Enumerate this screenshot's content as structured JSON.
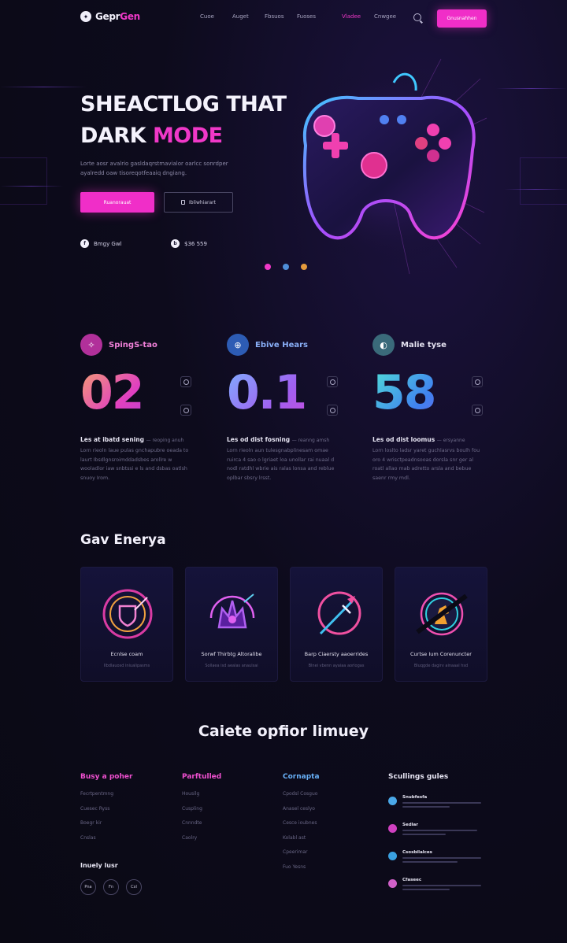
{
  "nav": {
    "logo_prefix": "Gepr",
    "logo_accent": "Gen",
    "links": [
      "Cuoe",
      "Auget",
      "Fbsuos",
      "Fuoses",
      "Vladee",
      "Cnwgee"
    ],
    "active_index": 4,
    "cta_label": "Gnusnahhen"
  },
  "hero": {
    "title_line1": "SHEACTLOG THAT",
    "title_line2_plain": "DARK",
    "title_line2_accent": "MODE",
    "subtitle": "Lorte aosr avalrio gasldaqrstmavialor oarlcc sonrdper ayalredd oaw tisoreqotfeaaiq dngiang.",
    "primary_button": "Ruanorauat",
    "secondary_button": "Ibliwhiarart",
    "meta": [
      {
        "icon": "f",
        "label": "Bmgy Gwl"
      },
      {
        "icon": "b",
        "label": "$36 559"
      }
    ],
    "dot_colors": [
      "#f038c8",
      "#4f8ed8",
      "#e59a3c"
    ]
  },
  "stats": [
    {
      "title": "SpingS-tao",
      "value": "02",
      "lead": "Les at ibatd sening",
      "lead_tail": "— reoping anuh",
      "body": "Lorn rieoln laue pulas gnchapubre oeada to laurt Ibsdlgnsroimddadsbes arollre w wooladlor iaw snbtssi e ls and dsbas oatlsh snuoy Irom.",
      "icon": "✧",
      "icon_bg": "#b1309a",
      "title_color": "#f080d8",
      "grad": "linear-gradient(135deg,#f5a070 0%,#e040c0 45%,#9040e0 100%)"
    },
    {
      "title": "Ebive Hears",
      "value": "0.1",
      "lead": "Les od dist fosning",
      "lead_tail": "— reanng amsh",
      "body": "Lorn rieoln aun tulesgnabplinesam omae ruirca 4 sao o lgriaet loa unollar rai nuaal d nodl ratdhl wbrie ais ralas lonsa and reblue oplbar sbsry lrsst.",
      "icon": "⊕",
      "icon_bg": "#2d5cb4",
      "title_color": "#8ab0f8",
      "grad": "linear-gradient(135deg,#7fb0ff 0%,#a060f0 50%,#e040d0 100%)"
    },
    {
      "title": "Malie tyse",
      "value": "58",
      "lead": "Les od dist loomus",
      "lead_tail": "— ersyanne",
      "body": "Lorn loslto ladsr yaret guchlasrvs boulh fou oro 4 wrisctpeadnsooas dorsla snr ger al roatl allao mab adretto arsla and bebue saenr rmy mdl.",
      "icon": "◐",
      "icon_bg": "#3a6a7a",
      "title_color": "#e4e2f0",
      "grad": "linear-gradient(135deg,#50e0d8 0%,#4080f0 50%,#a050e0 100%)"
    }
  ],
  "energy": {
    "title": "Gav Enerya",
    "cards": [
      {
        "title": "Ecnlse coam",
        "sub": "Ilbdlauosd iniualipasms",
        "icon": "shield-icon",
        "c1": "#f040b0",
        "c2": "#f0a040"
      },
      {
        "title": "Sorwf Thirbtg Altoralibe",
        "sub": "Sollaea isd aealas anaulsai",
        "icon": "crown-icon",
        "c1": "#9040e0",
        "c2": "#e060f0"
      },
      {
        "title": "Barp Ciaersty aaoerrides",
        "sub": "Blnei vbenn ayaiaa aorlogas",
        "icon": "sword-icon",
        "c1": "#f050a0",
        "c2": "#40c0f0"
      },
      {
        "title": "Curtse Ium Corenuncter",
        "sub": "Bluqgde dagirv ainaaal hsd",
        "icon": "warrior-icon",
        "c1": "#30d0e0",
        "c2": "#f0a030"
      }
    ]
  },
  "footer": {
    "title": "Caiete opfior limuey",
    "columns": [
      {
        "title": "Busy a poher",
        "color": "#f050d0",
        "items": [
          "Fecrtpentmng",
          "Cuesec Ryss",
          "Boegr kir",
          "Cnslas"
        ]
      },
      {
        "title": "Parftulled",
        "color": "#f050d0",
        "items": [
          "Housilg",
          "Cuspling",
          "Cnnndte",
          "Caolry"
        ]
      },
      {
        "title": "Cornapta",
        "color": "#68b0f8",
        "items": [
          "Cpodsl Cosguo",
          "Anasel ceslyo",
          "Cesce ioubnes",
          "Kolabl ast",
          "Cpeerimar",
          "Fuo Yesns"
        ]
      }
    ],
    "social_title": "Inuely lusr",
    "social": [
      "Pna",
      "Fn",
      "Cxl"
    ],
    "news_title": "Scullings gules",
    "news": [
      {
        "label": "Snubfesfa",
        "color": "#4aa8e8"
      },
      {
        "label": "Sedlar",
        "color": "#d040c0"
      },
      {
        "label": "Csosbilalces",
        "color": "#3aa0e0"
      },
      {
        "label": "Cfaseec",
        "color": "#d060c8"
      }
    ]
  }
}
